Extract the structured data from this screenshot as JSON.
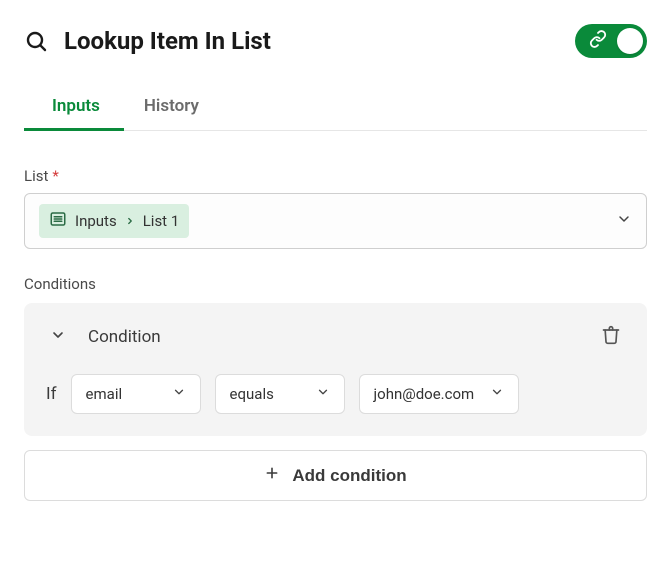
{
  "header": {
    "title": "Lookup Item In List",
    "toggle_on": true
  },
  "tabs": {
    "items": [
      {
        "label": "Inputs",
        "active": true
      },
      {
        "label": "History",
        "active": false
      }
    ]
  },
  "form": {
    "list_label": "List",
    "list_required_marker": "*",
    "list_breadcrumb": {
      "part1": "Inputs",
      "part2": "List 1"
    },
    "conditions_label": "Conditions",
    "condition_title": "Condition",
    "condition_row": {
      "if_label": "If",
      "field": "email",
      "operator": "equals",
      "value": "john@doe.com"
    },
    "add_condition_label": "Add condition"
  }
}
